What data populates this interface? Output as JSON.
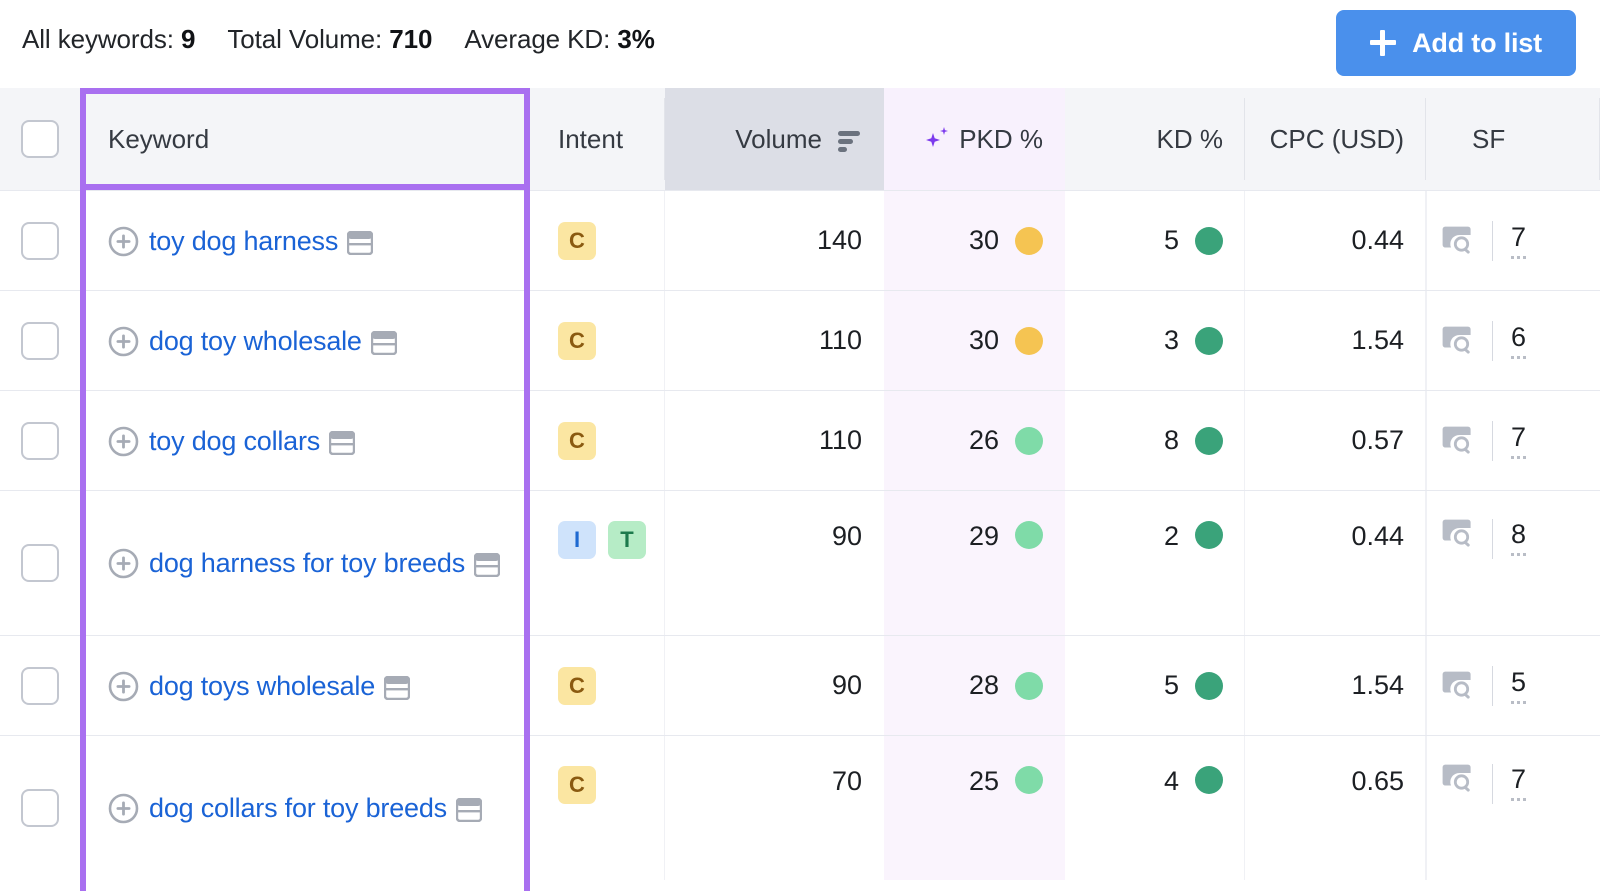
{
  "summary": {
    "stats": [
      {
        "label": "All keywords:",
        "value": "9"
      },
      {
        "label": "Total Volume:",
        "value": "710"
      },
      {
        "label": "Average KD:",
        "value": "3%"
      }
    ],
    "add_to_list_label": "Add to list"
  },
  "colors": {
    "accent_button": "#4a90ec",
    "highlight_box": "#a970f0",
    "link": "#1a63d6",
    "pkd_column_bg": "#faf4fd",
    "volume_header_bg": "#dcdee6",
    "header_bg": "#f4f5f8",
    "dot_orange": "#f5c452",
    "dot_mint": "#7fdba8",
    "dot_teal": "#3aa37a"
  },
  "table": {
    "columns": [
      {
        "key": "checkbox",
        "label": ""
      },
      {
        "key": "keyword",
        "label": "Keyword"
      },
      {
        "key": "intent",
        "label": "Intent"
      },
      {
        "key": "volume",
        "label": "Volume",
        "sorted": "desc"
      },
      {
        "key": "pkd",
        "label": "PKD %",
        "ai": true
      },
      {
        "key": "kd",
        "label": "KD %"
      },
      {
        "key": "cpc",
        "label": "CPC (USD)"
      },
      {
        "key": "sf",
        "label": "SF"
      }
    ],
    "rows": [
      {
        "keyword": "toy dog harness",
        "intent": [
          "C"
        ],
        "volume": "140",
        "pkd": "30",
        "pkd_color": "#f5c452",
        "kd": "5",
        "kd_color": "#3aa37a",
        "cpc": "0.44",
        "sf": "7"
      },
      {
        "keyword": "dog toy wholesale",
        "intent": [
          "C"
        ],
        "volume": "110",
        "pkd": "30",
        "pkd_color": "#f5c452",
        "kd": "3",
        "kd_color": "#3aa37a",
        "cpc": "1.54",
        "sf": "6"
      },
      {
        "keyword": "toy dog collars",
        "intent": [
          "C"
        ],
        "volume": "110",
        "pkd": "26",
        "pkd_color": "#7fdba8",
        "kd": "8",
        "kd_color": "#3aa37a",
        "cpc": "0.57",
        "sf": "7"
      },
      {
        "keyword": "dog harness for toy breeds",
        "intent": [
          "I",
          "T"
        ],
        "volume": "90",
        "pkd": "29",
        "pkd_color": "#7fdba8",
        "kd": "2",
        "kd_color": "#3aa37a",
        "cpc": "0.44",
        "sf": "8"
      },
      {
        "keyword": "dog toys wholesale",
        "intent": [
          "C"
        ],
        "volume": "90",
        "pkd": "28",
        "pkd_color": "#7fdba8",
        "kd": "5",
        "kd_color": "#3aa37a",
        "cpc": "1.54",
        "sf": "5"
      },
      {
        "keyword": "dog collars for toy breeds",
        "intent": [
          "C"
        ],
        "volume": "70",
        "pkd": "25",
        "pkd_color": "#7fdba8",
        "kd": "4",
        "kd_color": "#3aa37a",
        "cpc": "0.65",
        "sf": "7"
      }
    ]
  },
  "icons": {
    "add_keyword": "plus-circle-icon",
    "serp_preview": "serp-preview-icon",
    "sort": "sort-descending-icon",
    "sparkle": "ai-sparkle-icon",
    "sf_feature": "serp-feature-image-icon"
  }
}
